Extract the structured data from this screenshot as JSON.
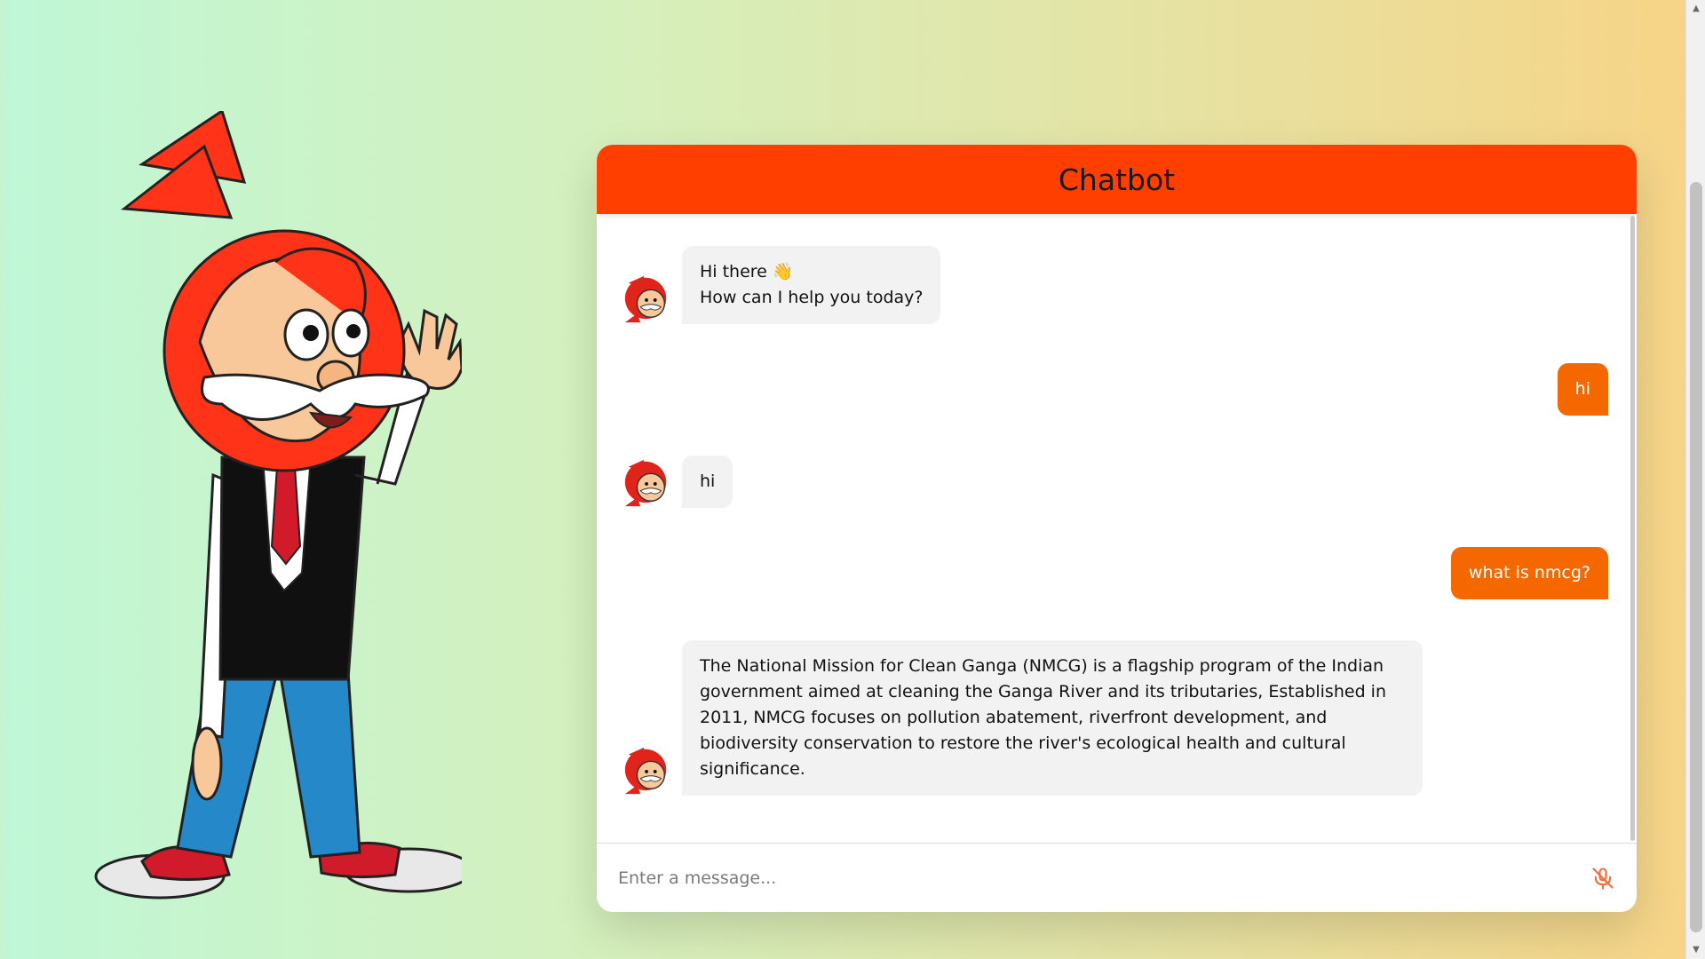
{
  "chat": {
    "title": "Chatbot",
    "input_placeholder": "Enter a message...",
    "messages": [
      {
        "role": "incoming",
        "text": "Hi there 👋\nHow can I help you today?"
      },
      {
        "role": "outgoing",
        "text": "hi"
      },
      {
        "role": "incoming",
        "text": "hi"
      },
      {
        "role": "outgoing",
        "text": "what is nmcg?"
      },
      {
        "role": "incoming",
        "text": "The National Mission for Clean Ganga (NMCG) is a flagship program of the Indian\ngovernment aimed at cleaning the Ganga River and its tributaries, Established in\n2011, NMCG focuses on pollution abatement, riverfront development, and\nbiodiversity conservation to restore the river's ecological health and cultural\nsignificance."
      }
    ]
  },
  "icons": {
    "mic": "mic-off-icon",
    "avatar": "bot-avatar-icon",
    "mascot": "turban-mascot-illustration"
  },
  "colors": {
    "header": "#ff3f00",
    "user_bubble": "#f56800",
    "bot_bubble": "#f2f2f2"
  }
}
